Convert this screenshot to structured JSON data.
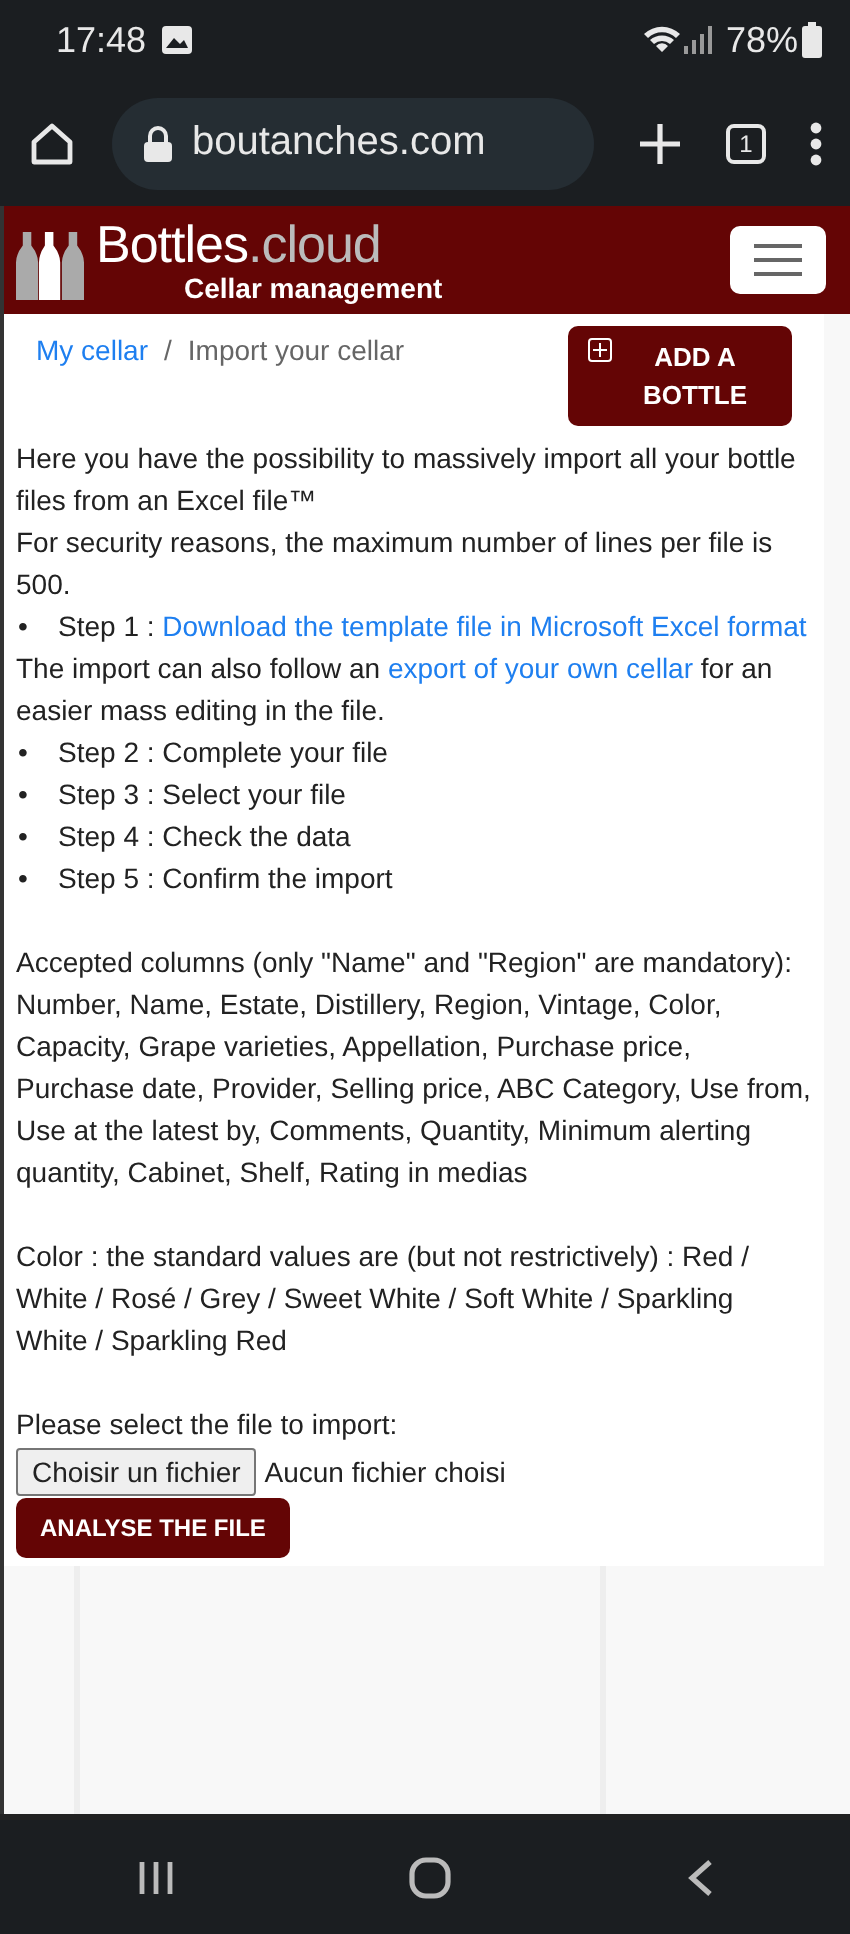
{
  "status_bar": {
    "time": "17:48",
    "battery": "78%"
  },
  "browser": {
    "url": "boutanches.com",
    "tab_count": "1"
  },
  "header": {
    "logo_name": "Bottles",
    "logo_suffix": ".cloud",
    "tagline": "Cellar management"
  },
  "breadcrumb": {
    "separator": "/",
    "items": [
      {
        "label": "My cellar",
        "kind": "link"
      },
      {
        "label": "Import your cellar",
        "kind": "current"
      }
    ]
  },
  "add_button": {
    "label": "ADD A BOTTLE"
  },
  "intro": [
    {
      "kind": "line",
      "segments": [
        {
          "kind": "text",
          "text": "Here you have the possibility to massively import all your bottle files from an Excel file™"
        }
      ]
    },
    {
      "kind": "line",
      "segments": [
        {
          "kind": "text",
          "text": "For security reasons, the maximum number of lines per file is 500."
        }
      ]
    },
    {
      "kind": "step",
      "bullet": "•",
      "segments": [
        {
          "kind": "text",
          "text": "Step 1 : "
        },
        {
          "kind": "link",
          "text": "Download the template file in Microsoft Excel format"
        }
      ]
    },
    {
      "kind": "line",
      "segments": [
        {
          "kind": "text",
          "text": "The import can also follow an "
        },
        {
          "kind": "link",
          "text": "export of your own cellar"
        },
        {
          "kind": "text",
          "text": " for an easier mass editing in the file."
        }
      ]
    },
    {
      "kind": "step",
      "bullet": "•",
      "segments": [
        {
          "kind": "text",
          "text": "Step 2 : Complete your file"
        }
      ]
    },
    {
      "kind": "step",
      "bullet": "•",
      "segments": [
        {
          "kind": "text",
          "text": "Step 3 : Select your file"
        }
      ]
    },
    {
      "kind": "step",
      "bullet": "•",
      "segments": [
        {
          "kind": "text",
          "text": "Step 4 : Check the data"
        }
      ]
    },
    {
      "kind": "step",
      "bullet": "•",
      "segments": [
        {
          "kind": "text",
          "text": "Step 5 : Confirm the import"
        }
      ]
    }
  ],
  "columns_note": "Accepted columns (only \"Name\" and \"Region\" are mandatory): Number, Name, Estate, Distillery, Region, Vintage, Color, Capacity, Grape varieties, Appellation, Purchase price, Purchase date, Provider, Selling price, ABC Category, Use from, Use at the latest by, Comments, Quantity, Minimum alerting quantity, Cabinet, Shelf, Rating in medias",
  "color_note": "Color : the standard values are (but not restrictively) : Red / White / Rosé / Grey / Sweet White / Soft White / Sparkling White / Sparkling Red",
  "form": {
    "label": "Please select the file to import:",
    "choose_button": "Choisir un fichier",
    "file_status": "Aucun fichier choisi",
    "submit": "ANALYSE THE FILE"
  }
}
